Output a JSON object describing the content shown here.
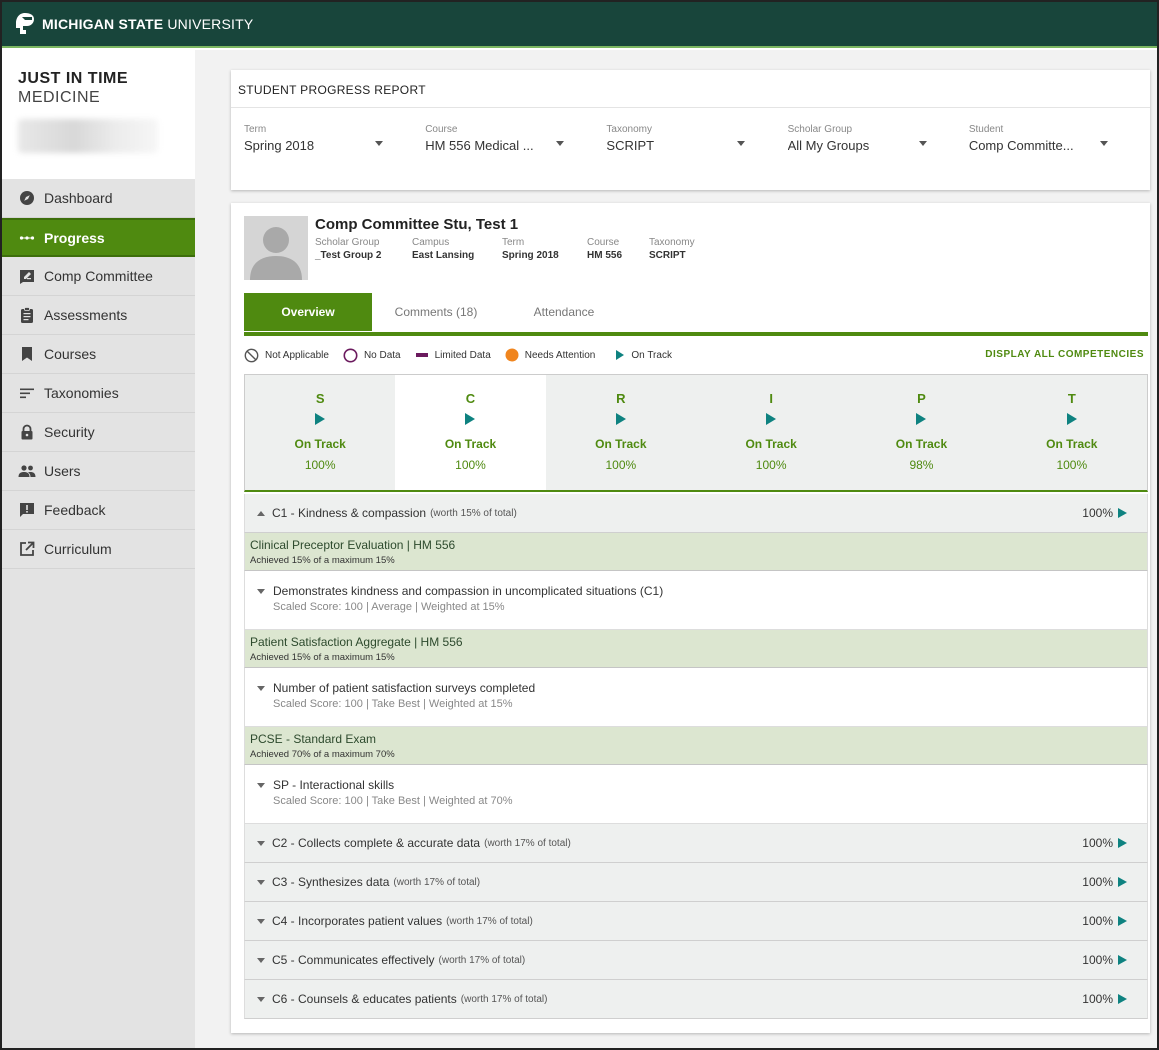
{
  "header": {
    "brand_bold": "MICHIGAN STATE",
    "brand_light": "UNIVERSITY"
  },
  "app": {
    "title_line1": "JUST IN TIME",
    "title_line2": "MEDICINE"
  },
  "sidebar": {
    "items": [
      {
        "label": "Dashboard",
        "icon": "compass-icon"
      },
      {
        "label": "Progress",
        "icon": "dots-icon",
        "active": true
      },
      {
        "label": "Comp Committee",
        "icon": "edit-icon"
      },
      {
        "label": "Assessments",
        "icon": "clipboard-icon"
      },
      {
        "label": "Courses",
        "icon": "bookmark-icon"
      },
      {
        "label": "Taxonomies",
        "icon": "sort-lines-icon"
      },
      {
        "label": "Security",
        "icon": "lock-icon"
      },
      {
        "label": "Users",
        "icon": "users-icon"
      },
      {
        "label": "Feedback",
        "icon": "feedback-icon"
      },
      {
        "label": "Curriculum",
        "icon": "external-link-icon"
      }
    ]
  },
  "report": {
    "title": "STUDENT PROGRESS REPORT",
    "filters": [
      {
        "label": "Term",
        "value": "Spring 2018"
      },
      {
        "label": "Course",
        "value": "HM 556 Medical ..."
      },
      {
        "label": "Taxonomy",
        "value": "SCRIPT"
      },
      {
        "label": "Scholar Group",
        "value": "All My Groups"
      },
      {
        "label": "Student",
        "value": "Comp Committe..."
      }
    ]
  },
  "student": {
    "name": "Comp Committee Stu, Test 1",
    "meta": [
      {
        "label": "Scholar Group",
        "value": "_Test Group 2"
      },
      {
        "label": "Campus",
        "value": "East Lansing"
      },
      {
        "label": "Term",
        "value": "Spring 2018"
      },
      {
        "label": "Course",
        "value": "HM 556"
      },
      {
        "label": "Taxonomy",
        "value": "SCRIPT"
      }
    ]
  },
  "tabs": [
    "Overview",
    "Comments (18)",
    "Attendance"
  ],
  "legend": {
    "not_applicable": "Not Applicable",
    "no_data": "No Data",
    "limited_data": "Limited Data",
    "needs_attention": "Needs Attention",
    "on_track": "On Track",
    "display_all": "DISPLAY ALL COMPETENCIES"
  },
  "colors": {
    "green": "#4f8a10",
    "teal": "#0e8280",
    "msu_green": "#18453b",
    "orange": "#f0851e",
    "purple": "#6b1a5e"
  },
  "taxonomy": [
    {
      "letter": "S",
      "status": "On Track",
      "pct": "100%"
    },
    {
      "letter": "C",
      "status": "On Track",
      "pct": "100%",
      "selected": true
    },
    {
      "letter": "R",
      "status": "On Track",
      "pct": "100%"
    },
    {
      "letter": "I",
      "status": "On Track",
      "pct": "100%"
    },
    {
      "letter": "P",
      "status": "On Track",
      "pct": "98%"
    },
    {
      "letter": "T",
      "status": "On Track",
      "pct": "100%"
    }
  ],
  "competencies": {
    "c1": {
      "name": "C1 - Kindness & compassion",
      "worth": "(worth 15% of total)",
      "pct": "100%"
    },
    "assessments": [
      {
        "name": "Clinical Preceptor Evaluation | HM 556",
        "achieved": "Achieved 15% of a maximum 15%",
        "item": "Demonstrates kindness and compassion in uncomplicated situations (C1)",
        "score": "Scaled Score: 100 | Average | Weighted at 15%"
      },
      {
        "name": "Patient Satisfaction Aggregate | HM 556",
        "achieved": "Achieved 15% of a maximum 15%",
        "item": "Number of patient satisfaction surveys completed",
        "score": "Scaled Score: 100 | Take Best | Weighted at 15%"
      },
      {
        "name": "PCSE - Standard Exam",
        "achieved": "Achieved 70% of a maximum 70%",
        "item": "SP - Interactional skills",
        "score": "Scaled Score: 100 | Take Best | Weighted at 70%"
      }
    ],
    "others": [
      {
        "name": "C2 - Collects complete & accurate data",
        "worth": "(worth 17% of total)",
        "pct": "100%"
      },
      {
        "name": "C3 - Synthesizes data",
        "worth": "(worth 17% of total)",
        "pct": "100%"
      },
      {
        "name": "C4 - Incorporates patient values",
        "worth": "(worth 17% of total)",
        "pct": "100%"
      },
      {
        "name": "C5 - Communicates effectively",
        "worth": "(worth 17% of total)",
        "pct": "100%"
      },
      {
        "name": "C6 - Counsels & educates patients",
        "worth": "(worth 17% of total)",
        "pct": "100%"
      }
    ]
  }
}
